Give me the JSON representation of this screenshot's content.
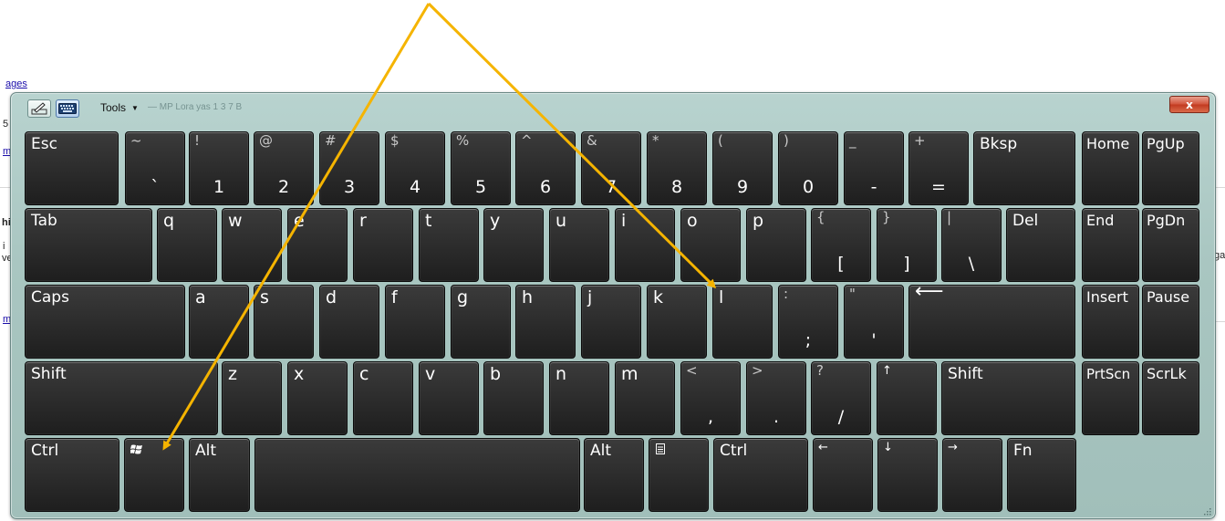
{
  "background_page": {
    "link_top": "ages",
    "fragments": [
      "5",
      "m",
      "hi",
      "i",
      "ve",
      "m",
      "ga"
    ]
  },
  "toolbar": {
    "tools_label": "Tools",
    "title_ghost": "— MP Lora yas 1 3 7 B",
    "close_label": "x",
    "pen_icon": "pen-input-icon",
    "keyboard_icon": "keyboard-icon"
  },
  "keys": {
    "esc": "Esc",
    "tilde_top": "~",
    "tilde_bottom": "`",
    "n1_top": "!",
    "n1": "1",
    "n2_top": "@",
    "n2": "2",
    "n3_top": "#",
    "n3": "3",
    "n4_top": "$",
    "n4": "4",
    "n5_top": "%",
    "n5": "5",
    "n6_top": "^",
    "n6": "6",
    "n7_top": "&",
    "n7": "7",
    "n8_top": "*",
    "n8": "8",
    "n9_top": "(",
    "n9": "9",
    "n0_top": ")",
    "n0": "0",
    "minus_top": "_",
    "minus": "-",
    "equal_top": "+",
    "equal": "=",
    "bksp": "Bksp",
    "home": "Home",
    "pgup": "PgUp",
    "tab": "Tab",
    "q": "q",
    "w": "w",
    "e": "e",
    "r": "r",
    "t": "t",
    "y": "y",
    "u": "u",
    "i": "i",
    "o": "o",
    "p": "p",
    "lbr_top": "{",
    "lbr": "[",
    "rbr_top": "}",
    "rbr": "]",
    "bs_top": "|",
    "bs": "\\",
    "del": "Del",
    "end": "End",
    "pgdn": "PgDn",
    "caps": "Caps",
    "a": "a",
    "s": "s",
    "d": "d",
    "f": "f",
    "g": "g",
    "h": "h",
    "j": "j",
    "k": "k",
    "l": "l",
    "semi_top": ":",
    "semi": ";",
    "quote_top": "\"",
    "quote": "'",
    "enter": "⟵",
    "insert": "Insert",
    "pause": "Pause",
    "shift": "Shift",
    "z": "z",
    "x": "x",
    "c": "c",
    "v": "v",
    "b": "b",
    "n": "n",
    "m": "m",
    "comma_top": "<",
    "comma": ",",
    "period_top": ">",
    "period": ".",
    "slash_top": "?",
    "slash": "/",
    "up": "↑",
    "rshift": "Shift",
    "prtscn": "PrtScn",
    "scrlk": "ScrLk",
    "ctrl": "Ctrl",
    "win": "win-logo-icon",
    "alt": "Alt",
    "ralt": "Alt",
    "menu": "menu-key-icon",
    "rctrl": "Ctrl",
    "left": "←",
    "down": "↓",
    "right": "→",
    "fn": "Fn"
  },
  "annotation": {
    "arrow_color": "#f5b400",
    "targets": [
      "win-key",
      "key-l"
    ]
  },
  "colors": {
    "key_face": "#2a2a2a",
    "window_bg": "#a9c6c1",
    "close_red": "#c23a20"
  }
}
